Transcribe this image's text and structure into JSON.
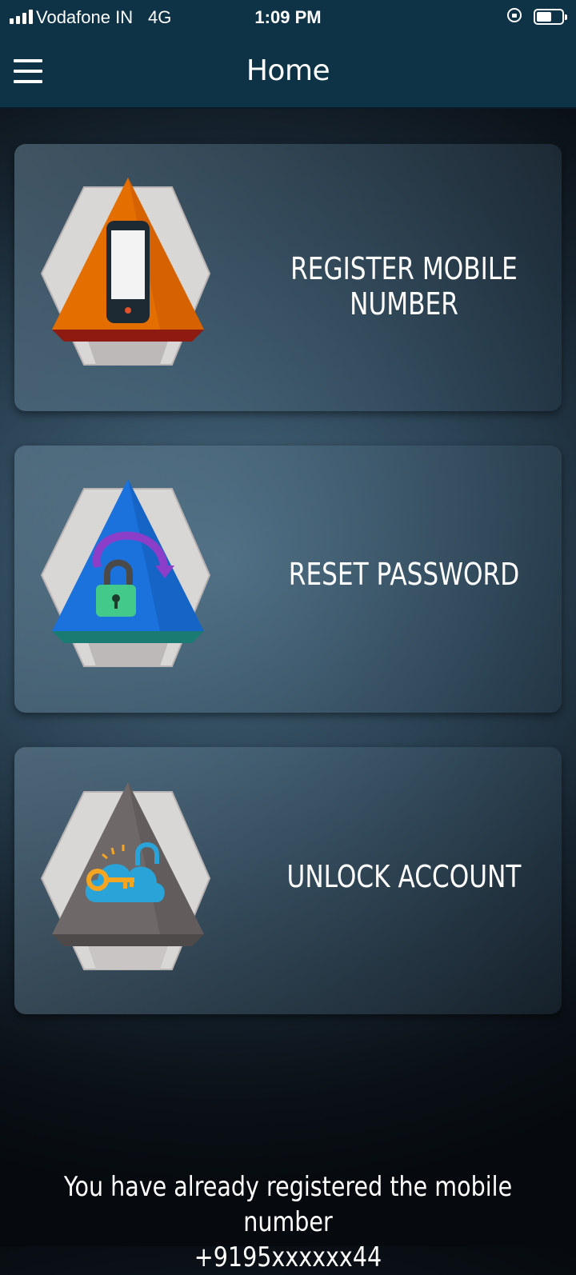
{
  "status_bar": {
    "carrier": "Vodafone IN",
    "network": "4G",
    "time": "1:09 PM",
    "battery_level": 0.6
  },
  "header": {
    "menu_icon": "hamburger-menu-icon",
    "title": "Home"
  },
  "cards": [
    {
      "label_lines": [
        "REGISTER MOBILE",
        "NUMBER"
      ],
      "icon": "mobile-phone-icon",
      "color": "#e06a00"
    },
    {
      "label_lines": [
        "RESET PASSWORD"
      ],
      "icon": "reset-lock-icon",
      "color": "#1a6fd6"
    },
    {
      "label_lines": [
        "UNLOCK ACCOUNT"
      ],
      "icon": "cloud-key-icon",
      "color": "#6b6666"
    }
  ],
  "footer": {
    "line1": "You have already registered the mobile number",
    "line2": "+9195xxxxxx44"
  },
  "colors": {
    "header_bg": "#0e3346",
    "text": "#ffffff"
  }
}
